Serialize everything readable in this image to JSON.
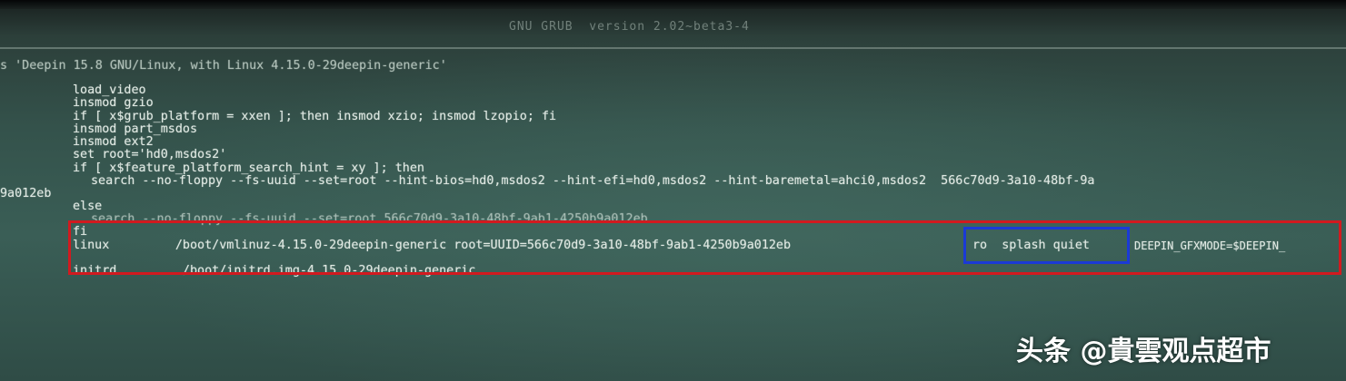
{
  "header": {
    "title": "GNU GRUB  version 2.02~beta3-4"
  },
  "editor": {
    "lines": [
      "s 'Deepin 15.8 GNU/Linux, with Linux 4.15.0-29deepin-generic'",
      "load_video",
      "insmod gzio",
      "if [ x$grub_platform = xxen ]; then insmod xzio; insmod lzopio; fi",
      "insmod part_msdos",
      "insmod ext2",
      "set root='hd0,msdos2'",
      "if [ x$feature_platform_search_hint = xy ]; then",
      "search --no-floppy --fs-uuid --set=root --hint-bios=hd0,msdos2 --hint-efi=hd0,msdos2 --hint-baremetal=ahci0,msdos2  566c70d9-3a10-48bf-9a",
      "9a012eb",
      "else",
      "search --no-floppy --fs-uuid --set=root 566c70d9-3a10-48bf-9ab1-4250b9a012eb",
      "fi",
      "linux         /boot/vmlinuz-4.15.0-29deepin-generic root=UUID=566c70d9-3a10-48bf-9ab1-4250b9a012eb",
      "ro  splash quiet",
      "DEEPIN_GFXMODE=$DEEPIN_",
      "initrd         /boot/initrd.img-4.15.0-29deepin-generic"
    ]
  },
  "watermark": {
    "text": "头条 @貴雲观点超市"
  },
  "colors": {
    "terminal_text": "#dfe8e2",
    "red_highlight": "#d21a1f",
    "blue_highlight": "#1b3ad6"
  }
}
